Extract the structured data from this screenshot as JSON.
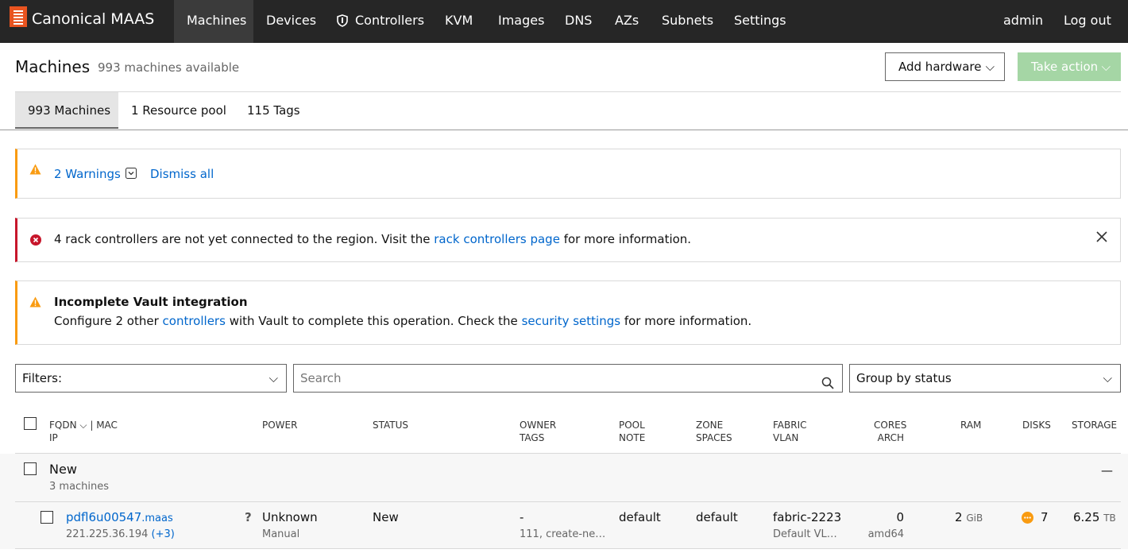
{
  "brand": {
    "name": "Canonical MAAS",
    "accent": "#e95420"
  },
  "nav": {
    "items": [
      "Machines",
      "Devices",
      "Controllers",
      "KVM",
      "Images",
      "DNS",
      "AZs",
      "Subnets",
      "Settings"
    ],
    "active": "Machines",
    "user": "admin",
    "logout": "Log out"
  },
  "header": {
    "title": "Machines",
    "subtitle": "993 machines available",
    "add_hardware": "Add hardware",
    "take_action": "Take action"
  },
  "tabs": [
    "993 Machines",
    "1 Resource pool",
    "115 Tags"
  ],
  "warnings": {
    "count_label": "2 Warnings",
    "dismiss": "Dismiss all"
  },
  "error_notice": {
    "prefix": "4 rack controllers are not yet connected to the region. Visit the",
    "link": "rack controllers page",
    "suffix": "for more information."
  },
  "vault_notice": {
    "title": "Incomplete Vault integration",
    "p1": "Configure 2 other",
    "link1": "controllers",
    "p2": "with Vault to complete this operation. Check the",
    "link2": "security settings",
    "p3": "for more information."
  },
  "controls": {
    "filters": "Filters:",
    "search_placeholder": "Search",
    "group_by": "Group by status"
  },
  "columns": {
    "fqdn": "FQDN",
    "mac": "| MAC",
    "ip": "IP",
    "power": "POWER",
    "status": "STATUS",
    "owner": "OWNER",
    "tags": "TAGS",
    "pool": "POOL",
    "note": "NOTE",
    "zone": "ZONE",
    "spaces": "SPACES",
    "fabric": "FABRIC",
    "vlan": "VLAN",
    "cores": "CORES",
    "arch": "ARCH",
    "ram": "RAM",
    "disks": "DISKS",
    "storage": "STORAGE"
  },
  "group": {
    "name": "New",
    "count": "3 machines",
    "collapse": "—"
  },
  "rows": [
    {
      "hostname": "pdfl6u00547",
      "domain": ".maas",
      "ip": "221.225.36.194",
      "ip_extra": "(+3)",
      "power_icon": "?",
      "power": "Unknown",
      "power_type": "Manual",
      "status": "New",
      "owner": "-",
      "tags": "111, create-ne…",
      "pool": "default",
      "zone": "default",
      "fabric": "fabric-2223",
      "vlan": "Default VL…",
      "cores": "0",
      "arch": "amd64",
      "ram": "2",
      "ram_unit": "GiB",
      "disks": "7",
      "storage": "6.25",
      "storage_unit": "TB"
    }
  ],
  "colors": {
    "warning": "#f99b11",
    "error": "#c7162b",
    "link": "#0066cc"
  }
}
